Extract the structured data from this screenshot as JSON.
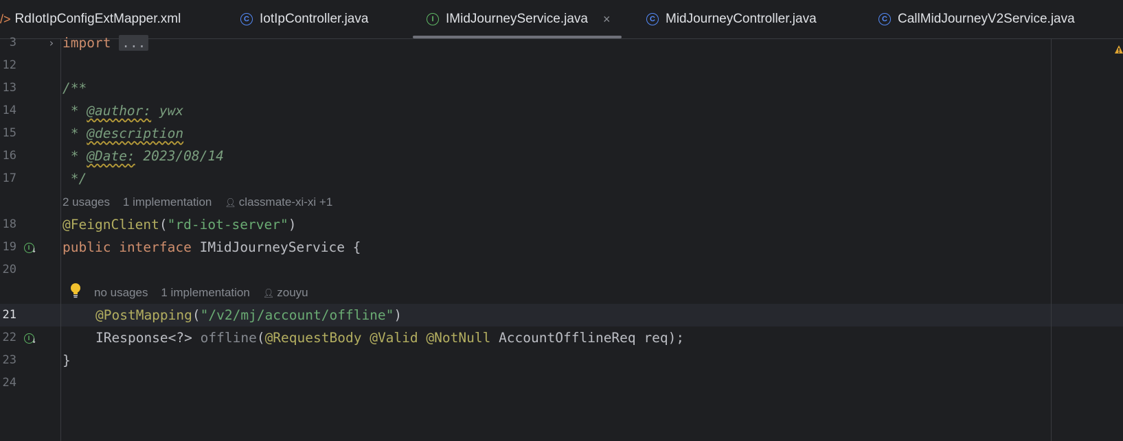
{
  "tabs": [
    {
      "label": "RdIotIpConfigExtMapper.xml",
      "icon": "xml-file-icon"
    },
    {
      "label": "IotIpController.java",
      "icon": "class-icon"
    },
    {
      "label": "IMidJourneyService.java",
      "icon": "interface-icon",
      "active": true
    },
    {
      "label": "MidJourneyController.java",
      "icon": "class-icon"
    },
    {
      "label": "CallMidJourneyV2Service.java",
      "icon": "class-icon"
    }
  ],
  "close_glyph": "×",
  "lines": {
    "n3": "3",
    "n12": "12",
    "n13": "13",
    "n14": "14",
    "n15": "15",
    "n16": "16",
    "n17": "17",
    "n18": "18",
    "n19": "19",
    "n20": "20",
    "n21": "21",
    "n22": "22",
    "n23": "23",
    "n24": "24"
  },
  "code": {
    "import_kw": "import",
    "folded": "...",
    "doc_open": "/**",
    "star": " * ",
    "author_tag": "@author:",
    "author_val": " ywx",
    "desc_tag": "@description",
    "date_tag": "@Date:",
    "date_val": " 2023/08/14",
    "doc_close": " */",
    "feign_ann": "@FeignClient",
    "feign_paren_open": "(",
    "feign_str": "\"rd-iot-server\"",
    "feign_paren_close": ")",
    "public_kw": "public",
    "interface_kw": "interface",
    "iface_name": " IMidJourneyService {",
    "post_ann": "@PostMapping",
    "post_open": "(",
    "post_str": "\"/v2/mj/account/offline\"",
    "post_close": ")",
    "ret_type": "IResponse<?> ",
    "method_name": "offline",
    "param_open": "(",
    "req_body": "@RequestBody",
    "valid": "@Valid",
    "notnull": "@NotNull",
    "param_rest": " AccountOfflineReq req);",
    "close_brace": "}"
  },
  "inlays": {
    "iface_usages": "2 usages",
    "iface_impl": "1 implementation",
    "iface_author": "classmate-xi-xi +1",
    "method_usages": "no usages",
    "method_impl": "1 implementation",
    "method_author": "zouyu"
  },
  "colors": {
    "background": "#1e1f22",
    "keyword": "#cf8e6d",
    "string": "#6aab73",
    "annotation": "#b3ae60",
    "comment": "#7a9e7e"
  }
}
